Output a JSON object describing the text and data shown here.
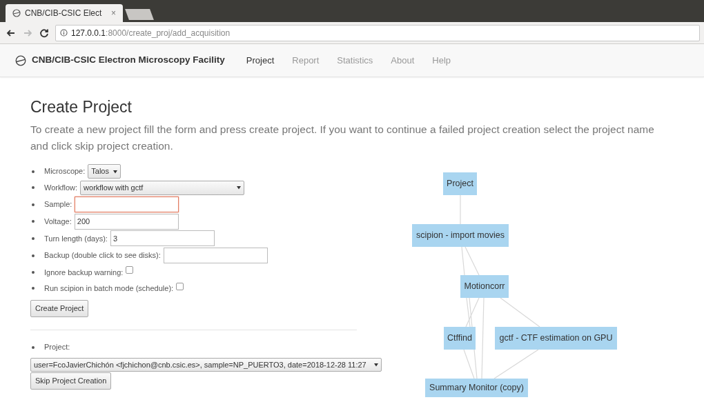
{
  "browser": {
    "tab": {
      "title": "CNB/CIB-CSIC Elect",
      "close": "×"
    },
    "nav_buttons": [
      {
        "kind": "back",
        "disabled": false
      },
      {
        "kind": "forward",
        "disabled": true
      },
      {
        "kind": "reload",
        "disabled": false
      }
    ],
    "url_host": "127.0.0.1",
    "url_path": ":8000/create_proj/add_acquisition"
  },
  "navbar": {
    "brand": "CNB/CIB-CSIC Electron Microscopy Facility",
    "items": [
      {
        "label": "Project",
        "selected": true
      },
      {
        "label": "Report",
        "selected": false
      },
      {
        "label": "Statistics",
        "selected": false
      },
      {
        "label": "About",
        "selected": false
      },
      {
        "label": "Help",
        "selected": false
      }
    ]
  },
  "heading": "Create Project",
  "intro": "To create a new project fill the form and press create project. If you want to continue a failed project creation select the project name and click skip project creation.",
  "form": {
    "fields": [
      {
        "kind": "select",
        "label": "Microscope:",
        "value": "Talos"
      },
      {
        "kind": "select",
        "label": "Workflow:",
        "value": "workflow with gctf"
      },
      {
        "kind": "input",
        "label": "Sample:",
        "invalid": true
      },
      {
        "kind": "input",
        "label": "Voltage:",
        "value": "200",
        "invalid": false
      },
      {
        "kind": "input",
        "label": "Turn length (days):",
        "value": "3",
        "invalid": false
      },
      {
        "kind": "input",
        "label": "Backup (double click to see disks):",
        "invalid": false
      },
      {
        "kind": "checkbox",
        "label": "Ignore backup warning:",
        "checked": false
      },
      {
        "kind": "checkbox",
        "label": "Run scipion in batch mode (schedule):",
        "checked": false
      }
    ],
    "submit": "Create Project"
  },
  "skip_form": {
    "label": "Project:",
    "project": "user=FcoJavierChichón <fjchichon@cnb.csic.es>, sample=NP_PUERTO3, date=2018-12-28 11:27",
    "button": "Skip Project Creation"
  },
  "workflow_graph": {
    "nodes": [
      {
        "label": "Project"
      },
      {
        "label": "scipion - import movies"
      },
      {
        "label": "Motioncorr"
      },
      {
        "label": "Ctffind"
      },
      {
        "label": "gctf - CTF estimation on GPU"
      },
      {
        "label": "Summary Monitor (copy)"
      }
    ]
  }
}
